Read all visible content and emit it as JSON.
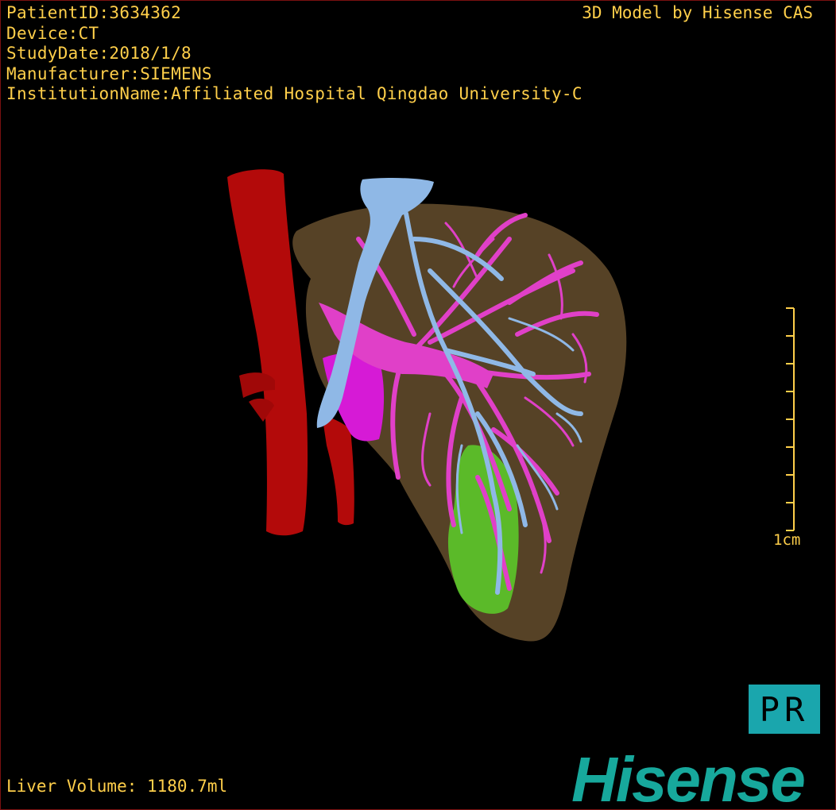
{
  "overlay": {
    "patient_id": "PatientID:3634362",
    "device": "Device:CT",
    "study_date": "StudyDate:2018/1/8",
    "manufacturer": "Manufacturer:SIEMENS",
    "institution": "InstitutionName:Affiliated Hospital Qingdao University-C",
    "model_credit": "3D Model by Hisense CAS",
    "liver_volume": "Liver Volume: 1180.7ml"
  },
  "scale_bar": {
    "label": "1cm",
    "color": "#ffcf4a"
  },
  "orientation": {
    "label": "PR",
    "background": "#1aa6ad"
  },
  "brand": {
    "logo_text": "Hisense",
    "color": "#17a89c"
  },
  "model": {
    "structures": [
      {
        "name": "liver",
        "color": "#8a6a3e"
      },
      {
        "name": "aorta",
        "color": "#b30a0a"
      },
      {
        "name": "portal-vein",
        "color": "#e040c8"
      },
      {
        "name": "hepatic-vein",
        "color": "#8fb8e6"
      },
      {
        "name": "gallbladder",
        "color": "#5ccf2a"
      },
      {
        "name": "tumor",
        "color": "#d61ad6"
      }
    ]
  },
  "text_color": "#ffcf4a"
}
